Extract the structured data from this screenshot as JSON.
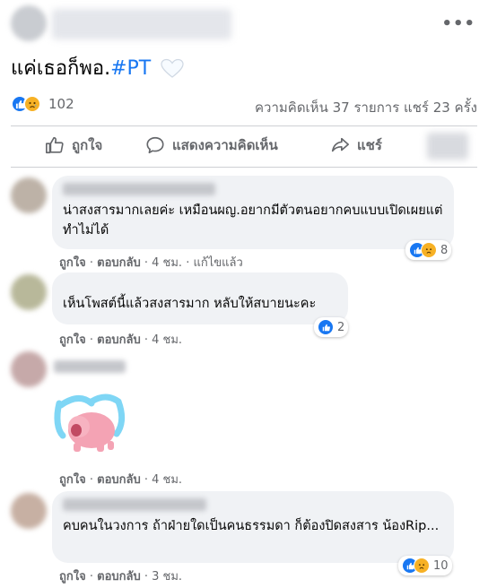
{
  "post": {
    "more_icon": "more-horizontal-icon",
    "text_main": "แค่เธอก็พอ.",
    "hashtag": "#PT",
    "heart_icon": "white-heart-icon",
    "reaction_count": "102",
    "stats_right": "ความคิดเห็น 37 รายการ  แชร์ 23 ครั้ง"
  },
  "actions": {
    "like": "ถูกใจ",
    "comment": "แสดงความคิดเห็น",
    "share": "แชร์"
  },
  "colors": {
    "link": "#1877f2",
    "meta": "#65676b",
    "bubble": "#f0f2f5",
    "sad": "#f7b125"
  },
  "comments": [
    {
      "text": "น่าสงสารมากเลยค่ะ เหมือนผญ.อยากมีตัวตนอยากคบแบบเปิดเผยแต่ทำไม่ได้",
      "like": "ถูกใจ",
      "reply": "ตอบกลับ",
      "time": "4 ชม.",
      "edited": "แก้ไขแล้ว",
      "reactions": "8"
    },
    {
      "text": "เห็นโพสต์นี้แล้วสงสารมาก หลับให้สบายนะคะ",
      "like": "ถูกใจ",
      "reply": "ตอบกลับ",
      "time": "4 ชม.",
      "reactions": "2"
    },
    {
      "sticker": "crying-pig-sticker",
      "like": "ถูกใจ",
      "reply": "ตอบกลับ",
      "time": "4 ชม."
    },
    {
      "text": "คบคนในวงการ ถ้าฝ่ายใดเป็นคนธรรมดา ก็ต้องปิดสงสาร น้องRip...",
      "like": "ถูกใจ",
      "reply": "ตอบกลับ",
      "time": "3 ชม.",
      "reactions": "10"
    }
  ]
}
